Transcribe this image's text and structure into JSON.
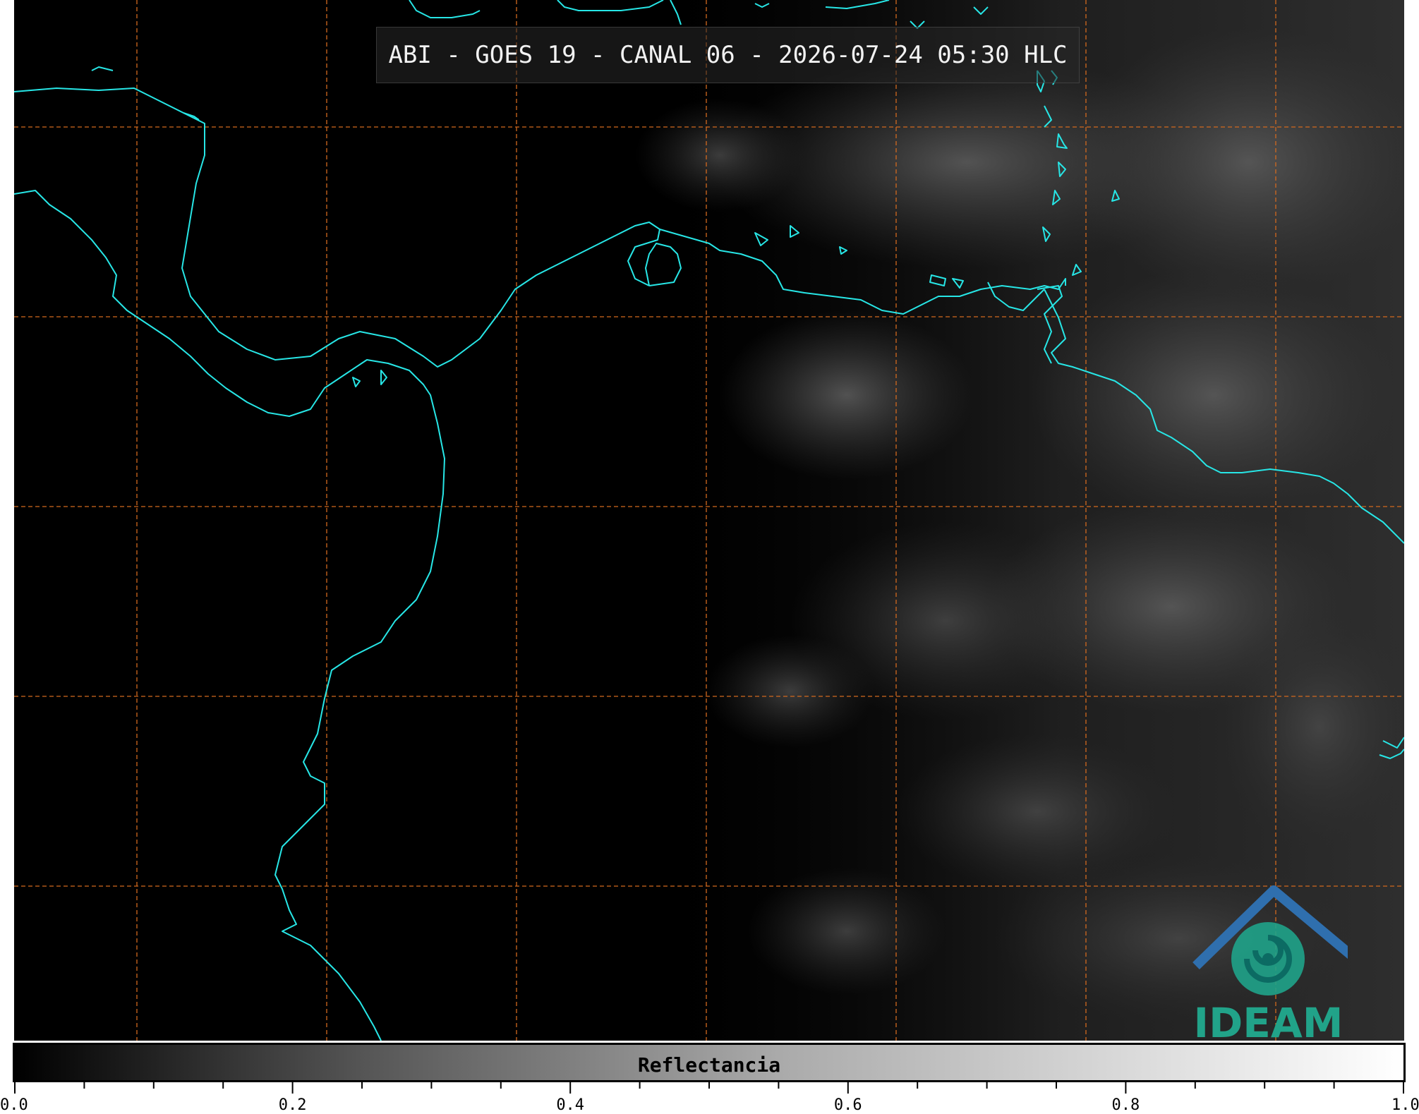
{
  "title": "ABI - GOES 19 - CANAL 06 - 2026-07-24 05:30 HLC",
  "colorbar": {
    "label": "Reflectancia",
    "min": 0.0,
    "max": 1.0,
    "tick_labels": [
      "0.0",
      "0.2",
      "0.4",
      "0.6",
      "0.8",
      "1.0"
    ],
    "minor_tick_step": 0.05,
    "gradient_colors": [
      "#000000",
      "#ffffff"
    ]
  },
  "logo": {
    "text": "IDEAM",
    "colors": {
      "roof": "#2f6fae",
      "swirl": "#1fa38a"
    }
  },
  "map": {
    "background": "#000000",
    "coastline_color": "#27e6e6",
    "grid_color": "#d2691e"
  }
}
